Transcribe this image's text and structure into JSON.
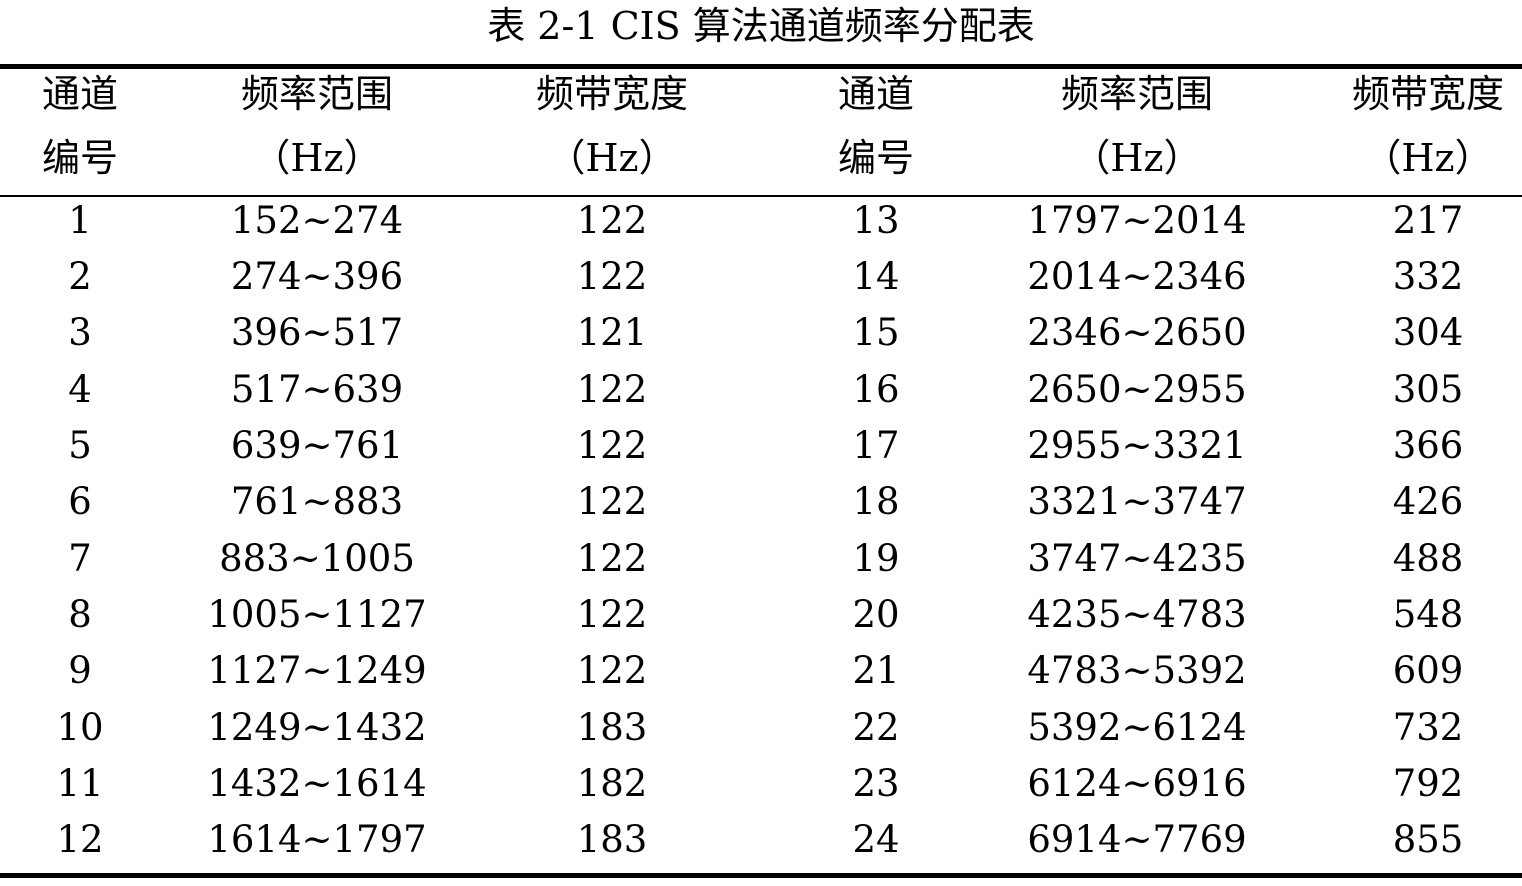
{
  "caption": "表 2-1 CIS 算法通道频率分配表",
  "headers": [
    {
      "line1": "通道",
      "line2": "编号"
    },
    {
      "line1": "频率范围",
      "line2": "（Hz）"
    },
    {
      "line1": "频带宽度",
      "line2": "（Hz）"
    },
    {
      "line1": "通道",
      "line2": "编号"
    },
    {
      "line1": "频率范围",
      "line2": "（Hz）"
    },
    {
      "line1": "频带宽度",
      "line2": "（Hz）"
    }
  ],
  "rows": [
    [
      "1",
      "152~274",
      "122",
      "13",
      "1797~2014",
      "217"
    ],
    [
      "2",
      "274~396",
      "122",
      "14",
      "2014~2346",
      "332"
    ],
    [
      "3",
      "396~517",
      "121",
      "15",
      "2346~2650",
      "304"
    ],
    [
      "4",
      "517~639",
      "122",
      "16",
      "2650~2955",
      "305"
    ],
    [
      "5",
      "639~761",
      "122",
      "17",
      "2955~3321",
      "366"
    ],
    [
      "6",
      "761~883",
      "122",
      "18",
      "3321~3747",
      "426"
    ],
    [
      "7",
      "883~1005",
      "122",
      "19",
      "3747~4235",
      "488"
    ],
    [
      "8",
      "1005~1127",
      "122",
      "20",
      "4235~4783",
      "548"
    ],
    [
      "9",
      "1127~1249",
      "122",
      "21",
      "4783~5392",
      "609"
    ],
    [
      "10",
      "1249~1432",
      "183",
      "22",
      "5392~6124",
      "732"
    ],
    [
      "11",
      "1432~1614",
      "182",
      "23",
      "6124~6916",
      "792"
    ],
    [
      "12",
      "1614~1797",
      "183",
      "24",
      "6914~7769",
      "855"
    ]
  ]
}
